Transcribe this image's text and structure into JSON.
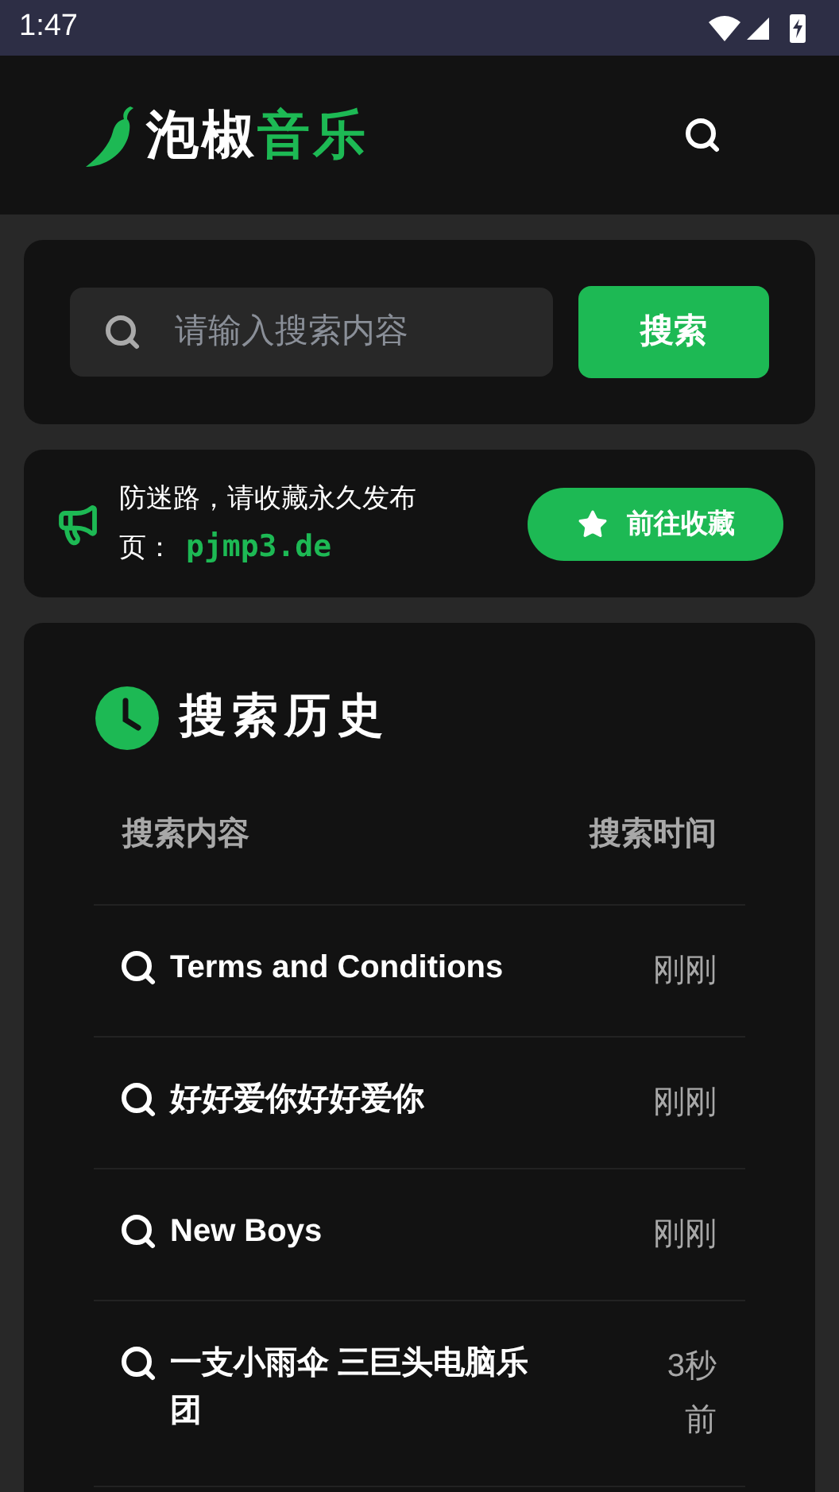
{
  "status_bar": {
    "time": "1:47"
  },
  "header": {
    "logo": {
      "primary": "泡椒",
      "accent": "音乐"
    }
  },
  "search": {
    "placeholder": "请输入搜索内容",
    "button": "搜索"
  },
  "notice": {
    "text": "防迷路，请收藏永久发布页：",
    "link": "pjmp3.de",
    "button": "前往收藏"
  },
  "history": {
    "title": "搜索历史",
    "columns": [
      "搜索内容",
      "搜索时间"
    ],
    "rows": [
      {
        "query": "Terms and Conditions",
        "time": "刚刚"
      },
      {
        "query": "好好爱你好好爱你",
        "time": "刚刚"
      },
      {
        "query": "New Boys",
        "time": "刚刚"
      },
      {
        "query": "一支小雨伞 三巨头电脑乐团",
        "time": "3秒前"
      }
    ]
  }
}
